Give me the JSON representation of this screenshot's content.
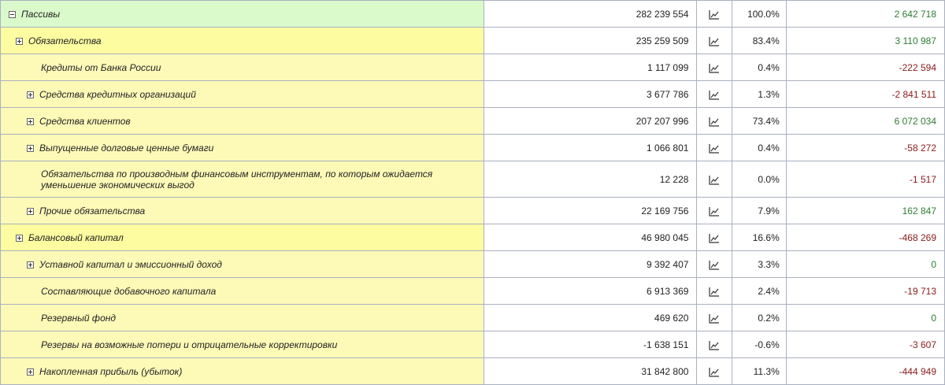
{
  "rows": [
    {
      "name": "Пассивы",
      "value": "282 239 554",
      "pct": "100.0%",
      "change": "2 642 718",
      "sign": "pos",
      "level": 0,
      "toggle": "minus"
    },
    {
      "name": "Обязательства",
      "value": "235 259 509",
      "pct": "83.4%",
      "change": "3 110 987",
      "sign": "pos",
      "level": 1,
      "toggle": "plus"
    },
    {
      "name": "Кредиты от Банка России",
      "value": "1 117 099",
      "pct": "0.4%",
      "change": "-222 594",
      "sign": "neg",
      "level": 2,
      "toggle": "none"
    },
    {
      "name": "Средства кредитных организаций",
      "value": "3 677 786",
      "pct": "1.3%",
      "change": "-2 841 511",
      "sign": "neg",
      "level": 2,
      "toggle": "plus"
    },
    {
      "name": "Средства клиентов",
      "value": "207 207 996",
      "pct": "73.4%",
      "change": "6 072 034",
      "sign": "pos",
      "level": 2,
      "toggle": "plus"
    },
    {
      "name": "Выпущенные долговые ценные бумаги",
      "value": "1 066 801",
      "pct": "0.4%",
      "change": "-58 272",
      "sign": "neg",
      "level": 2,
      "toggle": "plus"
    },
    {
      "name": "Обязательства по производным финансовым инструментам, по которым ожидается уменьшение экономических выгод",
      "value": "12 228",
      "pct": "0.0%",
      "change": "-1 517",
      "sign": "neg",
      "level": 2,
      "toggle": "none"
    },
    {
      "name": "Прочие обязательства",
      "value": "22 169 756",
      "pct": "7.9%",
      "change": "162 847",
      "sign": "pos",
      "level": 2,
      "toggle": "plus"
    },
    {
      "name": "Балансовый капитал",
      "value": "46 980 045",
      "pct": "16.6%",
      "change": "-468 269",
      "sign": "neg",
      "level": 1,
      "toggle": "plus"
    },
    {
      "name": "Уставной капитал и эмиссионный доход",
      "value": "9 392 407",
      "pct": "3.3%",
      "change": "0",
      "sign": "zero",
      "level": 2,
      "toggle": "plus"
    },
    {
      "name": "Составляющие добавочного капитала",
      "value": "6 913 369",
      "pct": "2.4%",
      "change": "-19 713",
      "sign": "neg",
      "level": 2,
      "toggle": "none"
    },
    {
      "name": "Резервный фонд",
      "value": "469 620",
      "pct": "0.2%",
      "change": "0",
      "sign": "zero",
      "level": 2,
      "toggle": "none"
    },
    {
      "name": "Резервы на возможные потери и отрицательные корректировки",
      "value": "-1 638 151",
      "pct": "-0.6%",
      "change": "-3 607",
      "sign": "neg",
      "level": 2,
      "toggle": "none"
    },
    {
      "name": "Накопленная прибыль (убыток)",
      "value": "31 842 800",
      "pct": "11.3%",
      "change": "-444 949",
      "sign": "neg",
      "level": 2,
      "toggle": "plus"
    }
  ],
  "icons": {
    "toggle_plus": "expand-icon",
    "toggle_minus": "collapse-icon",
    "chart": "line-chart-icon"
  },
  "colors": {
    "root_bg": "#dafacb",
    "group_bg": "#fdfca0",
    "item_bg": "#fdfab7",
    "positive": "#2e7d32",
    "negative": "#8b1a1a",
    "border": "#aab0c0"
  }
}
